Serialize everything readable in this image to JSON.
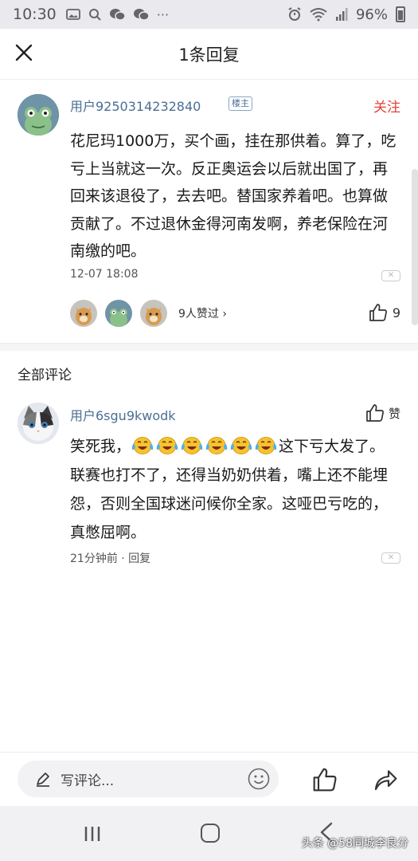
{
  "status_bar": {
    "time": "10:30",
    "notif_icons": [
      "image-icon",
      "search-icon",
      "wechat-icon",
      "wechat-icon",
      "more-icon"
    ],
    "more": "···",
    "battery_percent": "96%"
  },
  "header": {
    "title": "1条回复",
    "close_icon": "close-icon"
  },
  "main_reply": {
    "username": "用户9250314232840",
    "badge": "楼主",
    "follow_label": "关注",
    "content": "花尼玛1000万，买个画，挂在那供着。算了，吃亏上当就这一次。反正奥运会以后就出国了，再回来该退役了，去去吧。替国家养着吧。也算做贡献了。不过退休金得河南发啊，养老保险在河南缴的吧。",
    "timestamp": "12-07 18:08",
    "dislike_label": "✕",
    "likers_text": "9人赞过 ›",
    "like_count": "9",
    "accent": "#e3413a"
  },
  "section": {
    "title": "全部评论"
  },
  "comment": {
    "username": "用户6sgu9kwodk",
    "like_label": "赞",
    "content_before": "笑死我，",
    "emoji_count": 6,
    "emoji_icon": "crying-laughing-emoji-icon",
    "content_after": "这下亏大发了。联赛也打不了，还得当奶奶供着，嘴上还不能埋怨，否则全国球迷问候你全家。这哑巴亏吃的，真憋屈啊。",
    "meta": "21分钟前 · 回复",
    "dislike_label": "✕"
  },
  "bottom_bar": {
    "placeholder": "写评论...",
    "icons": [
      "pen-icon",
      "emoji-icon",
      "thumbs-up-icon",
      "share-icon"
    ]
  },
  "system_nav": {
    "buttons": [
      "recents-icon",
      "home-icon",
      "back-icon"
    ],
    "watermark": "头条 @58同城李良分"
  },
  "colors": {
    "username": "#4a6e94",
    "follow": "#e3413a",
    "status_bar_bg": "#e9e9ee"
  }
}
